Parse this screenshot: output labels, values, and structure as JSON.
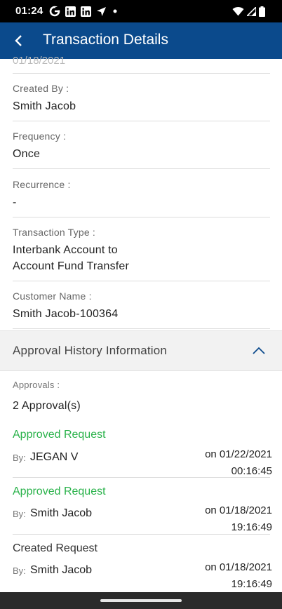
{
  "status_bar": {
    "time": "01:24",
    "icons": [
      "google-icon",
      "linkedin-icon",
      "linkedin-icon",
      "navigation-icon",
      "dot-icon",
      "wifi-icon",
      "signal-icon",
      "battery-icon"
    ]
  },
  "app_bar": {
    "title": "Transaction Details"
  },
  "details": {
    "faded_top_value": "01/18/2021",
    "created_by": {
      "label": "Created By :",
      "value": "Smith Jacob"
    },
    "frequency": {
      "label": "Frequency :",
      "value": "Once"
    },
    "recurrence": {
      "label": "Recurrence :",
      "value": "-"
    },
    "transaction_type": {
      "label": "Transaction Type :",
      "value_line1": "Interbank Account to",
      "value_line2": "Account Fund Transfer"
    },
    "customer_name": {
      "label": "Customer Name :",
      "value": "Smith Jacob-100364"
    }
  },
  "approval_section": {
    "title": "Approval History Information",
    "approvals_label": "Approvals :",
    "approvals_value": "2 Approval(s)",
    "entries": [
      {
        "status": "Approved Request",
        "by_label": "By:",
        "name": "JEGAN V",
        "date_line1": "on 01/22/2021",
        "date_line2": "00:16:45"
      },
      {
        "status": "Approved Request",
        "by_label": "By:",
        "name": "Smith Jacob",
        "date_line1": "on 01/18/2021",
        "date_line2": "19:16:49"
      },
      {
        "status": "Created Request",
        "by_label": "By:",
        "name": "Smith Jacob",
        "date_line1": "on 01/18/2021",
        "date_line2": "19:16:49"
      }
    ]
  },
  "colors": {
    "app_bar": "#0b4a8c",
    "approved": "#29b24a",
    "section_bg": "#f2f2f2"
  }
}
